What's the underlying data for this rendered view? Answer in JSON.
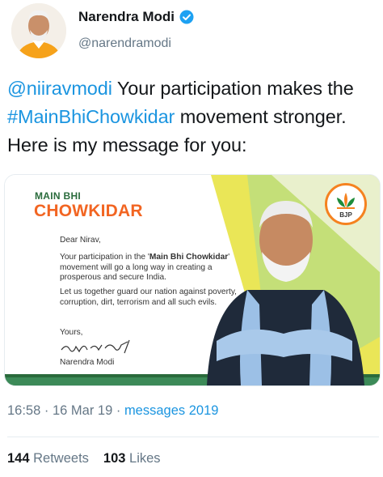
{
  "user": {
    "display_name": "Narendra Modi",
    "handle": "@narendramodi",
    "verified": true
  },
  "tweet": {
    "mention": "@niiravmodi",
    "text_1": " Your participation makes the ",
    "hashtag": "#MainBhiChowkidar",
    "text_2": " movement stronger. Here is my message for you:"
  },
  "card": {
    "logo_line1": "MAIN BHI",
    "logo_line2": "CHOWKIDAR",
    "greeting": "Dear Nirav,",
    "p1_before": "Your participation in the '",
    "p1_bold": "Main Bhi Chowkidar",
    "p1_after": "' movement will go a long way in creating a prosperous and secure India.",
    "p2": "Let us together guard our nation against poverty, corruption, dirt, terrorism and all such evils.",
    "closing": "Yours,",
    "signature_name": "Narendra Modi",
    "party_badge": "BJP"
  },
  "meta": {
    "time": "16:58",
    "sep1": " · ",
    "date": "16 Mar 19",
    "sep2": " · ",
    "source": "messages 2019"
  },
  "stats": {
    "retweets_count": "144",
    "retweets_label": "Retweets",
    "likes_count": "103",
    "likes_label": "Likes"
  },
  "colors": {
    "link": "#1b95e0",
    "verified": "#1da1f2",
    "saffron": "#f26522",
    "green": "#2a6b3c",
    "accent_yellow": "#e6e23a"
  }
}
